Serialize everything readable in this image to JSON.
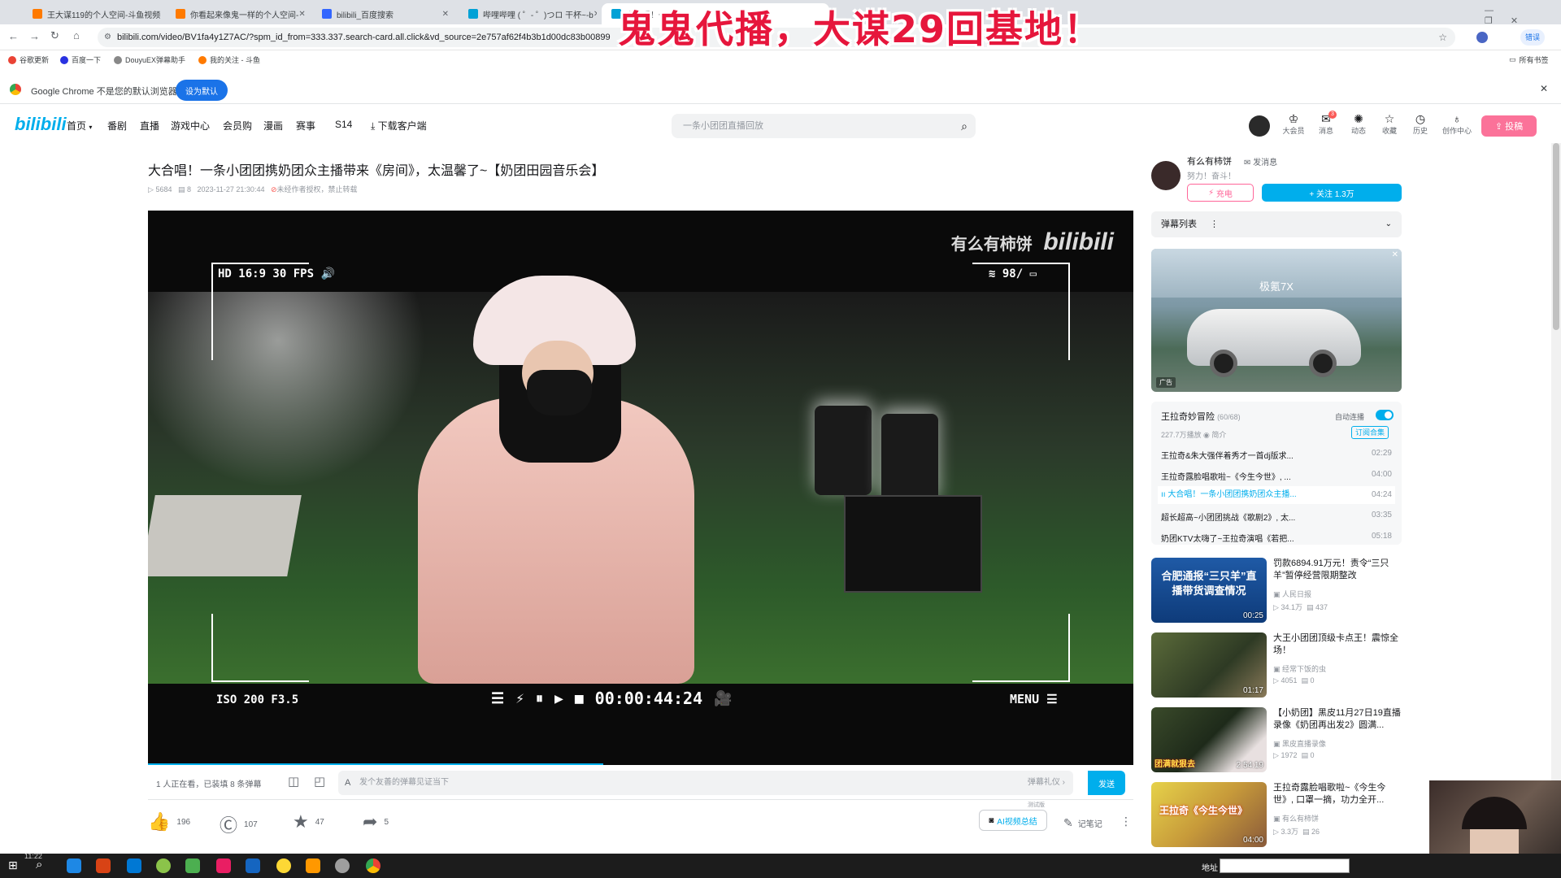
{
  "browser": {
    "tabs": [
      {
        "title": "王大谋119的个人空间-斗鱼视频",
        "color": "#ff7a00"
      },
      {
        "title": "你看起来像鬼一样的个人空间-",
        "color": "#ff7a00"
      },
      {
        "title": "bilibili_百度搜索",
        "color": "#3366ff"
      },
      {
        "title": "哔哩哔哩 ( ゜- ゜)つロ 干杯~-b",
        "color": "#00a1d6"
      },
      {
        "title": "大合唱！一条小",
        "color": "#00a1d6"
      }
    ],
    "tab_close": "✕",
    "url": "bilibili.com/video/BV1fa4y1Z7AC/?spm_id_from=333.337.search-card.all.click&vd_source=2e757af62f4b3b1d00dc83b00899",
    "profile_label": "错误",
    "bookmarks": [
      "谷歌更新",
      "百度一下",
      "DouyuEX弹幕助手",
      "我的关注 - 斗鱼"
    ],
    "all_bookmarks": "所有书签",
    "infobar_text": "Google Chrome 不是您的默认浏览器",
    "set_default_label": "设为默认"
  },
  "overlay_caption": "鬼鬼代播，大谋29回基地！",
  "site": {
    "logo": "bilibili",
    "nav": [
      "首页",
      "番剧",
      "直播",
      "游戏中心",
      "会员购",
      "漫画",
      "赛事",
      "S14",
      "下载客户端"
    ],
    "search_placeholder": "一条小团团直播回放",
    "header_icons": [
      "大会员",
      "消息",
      "动态",
      "收藏",
      "历史",
      "创作中心"
    ],
    "message_badge": "3",
    "upload_label": "投稿"
  },
  "video": {
    "title": "大合唱！一条小团团携奶团众主播带来《房间》，太温馨了~【奶团田园音乐会】",
    "views": "5684",
    "danmaku_count": "8",
    "date": "2023-11-27 21:30:44",
    "rights": "未经作者授权，禁止转载",
    "watermark_user": "有么有柿饼",
    "watermark_logo": "bilibili",
    "hud_top_left": "HD 16:9 30 FPS",
    "hud_top_right": "98/",
    "hud_bottom_left": "ISO 200  F3.5",
    "hud_time": "00:00:44:24",
    "hud_menu": "MENU"
  },
  "danmaku_bar": {
    "watching": "1 人正在看，已装填 8 条弹幕",
    "placeholder": "发个友善的弹幕见证当下",
    "etiquette": "弹幕礼仪 ›",
    "send": "发送"
  },
  "actions": {
    "likes": "196",
    "coins": "107",
    "favorites": "47",
    "shares": "5",
    "ai_summary": "AI视频总结",
    "ai_badge": "测试版",
    "notes": "记笔记"
  },
  "uploader": {
    "name": "有么有柿饼",
    "message": "发消息",
    "bio": "努力！奋斗！",
    "charge": "充电",
    "follow": "+ 关注 1.3万"
  },
  "danmaku_list_label": "弹幕列表",
  "ad": {
    "brand": "极氪7X",
    "badge": "广告"
  },
  "playlist": {
    "title": "王拉奇妙冒险",
    "progress": "(60/68)",
    "autoplay": "自动连播",
    "plays": "227.7万播放",
    "intro": "简介",
    "subscribe": "订阅合集",
    "items": [
      {
        "title": "王拉奇&朱大强伴着秀才一首dj版求...",
        "duration": "02:29"
      },
      {
        "title": "王拉奇露脸唱歌啦~《今生今世》, ...",
        "duration": "04:00"
      },
      {
        "title": "大合唱！一条小团团携奶团众主播...",
        "duration": "04:24"
      },
      {
        "title": "超长超高~小团团挑战《歌剧2》, 太...",
        "duration": "03:35"
      },
      {
        "title": "奶团KTV太嗨了~王拉奇演唱《若把...",
        "duration": "05:18"
      }
    ]
  },
  "recommendations": [
    {
      "thumb_text": "合肥通报“三只羊”直播带货调查情况",
      "duration": "00:25",
      "title": "罚款6894.91万元！责令“三只羊”暂停经营限期整改",
      "author": "人民日报",
      "views": "34.1万",
      "comments": "437"
    },
    {
      "thumb_text": "",
      "duration": "01:17",
      "title": "大王小团团顶级卡点王！震惊全场！",
      "author": "经常下饭的虫",
      "views": "4051",
      "comments": "0"
    },
    {
      "thumb_text": "团满就狠去",
      "duration": "2:54:19",
      "title": "【小奶团】黑皮11月27日19直播录像《奶团再出发2》圆满...",
      "author": "黑皮直播录像",
      "views": "1972",
      "comments": "0"
    },
    {
      "thumb_text": "王拉奇《今生今世》",
      "duration": "04:00",
      "title": "王拉奇露脸唱歌啦~《今生今世》, 口罩一摘，功力全开...",
      "author": "有么有柿饼",
      "views": "3.3万",
      "comments": "26"
    }
  ],
  "taskbar": {
    "address_label": "地址",
    "time": "11:22"
  },
  "colors": {
    "bili_blue": "#00aeec",
    "bili_pink": "#fb7299",
    "overlay_red": "#e6163c"
  }
}
